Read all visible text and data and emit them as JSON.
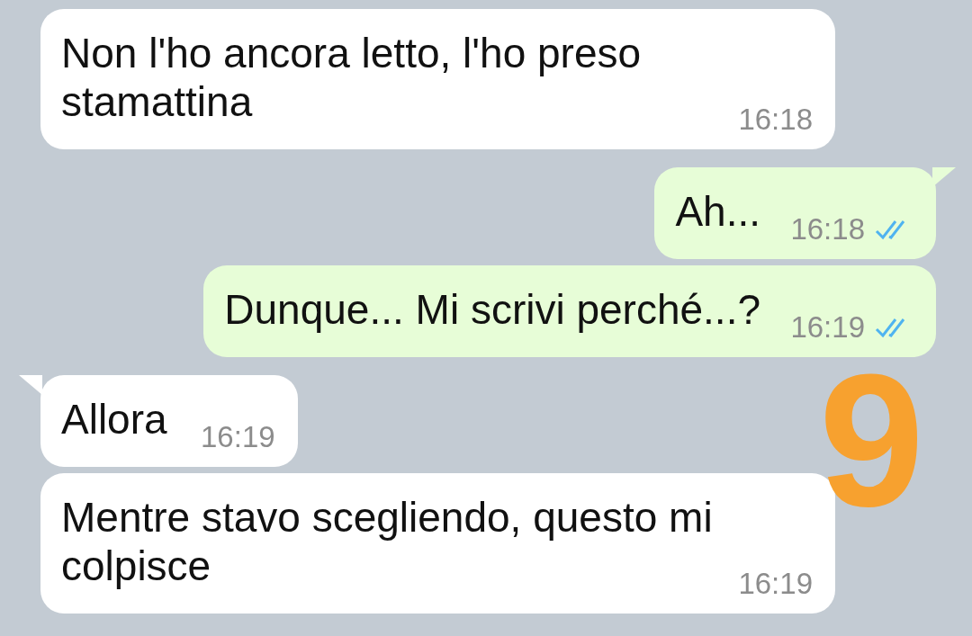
{
  "messages": [
    {
      "kind": "incoming",
      "tail": false,
      "text": "Non l'ho ancora letto, l'ho preso stamattina",
      "time": "16:18"
    },
    {
      "kind": "outgoing",
      "tail": true,
      "text": "Ah...",
      "time": "16:18",
      "read": true
    },
    {
      "kind": "outgoing",
      "tail": false,
      "text": "Dunque... Mi scrivi perché...?",
      "time": "16:19",
      "read": true
    },
    {
      "kind": "incoming",
      "tail": true,
      "text": "Allora",
      "time": "16:19"
    },
    {
      "kind": "incoming",
      "tail": false,
      "text": "Mentre stavo scegliendo, questo mi colpisce",
      "time": "16:19"
    }
  ],
  "annotation": {
    "text": "9"
  }
}
